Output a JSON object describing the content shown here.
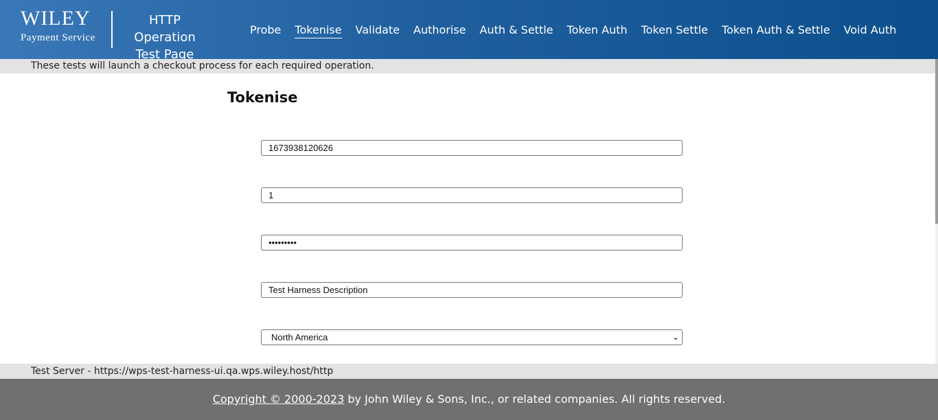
{
  "header": {
    "logo_main": "WILEY",
    "logo_sub": "Payment Service",
    "title_line1": "HTTP Operation",
    "title_line2": "Test Page",
    "nav": [
      {
        "label": "Probe"
      },
      {
        "label": "Tokenise",
        "active": true
      },
      {
        "label": "Validate"
      },
      {
        "label": "Authorise"
      },
      {
        "label": "Auth & Settle"
      },
      {
        "label": "Token Auth"
      },
      {
        "label": "Token Settle"
      },
      {
        "label": "Token Auth & Settle"
      },
      {
        "label": "Void Auth"
      }
    ]
  },
  "subbar_text": "These tests will launch a checkout process for each required operation.",
  "main": {
    "title": "Tokenise",
    "fields": [
      {
        "value": "1673938120626"
      },
      {
        "value": "1"
      },
      {
        "value": "•••••••••"
      },
      {
        "value": "Test Harness Description"
      },
      {
        "value": "North America"
      }
    ]
  },
  "server_text": "Test Server - https://wps-test-harness-ui.qa.wps.wiley.host/http",
  "footer": {
    "copyright_link": "Copyright © 2000-2023",
    "copyright_rest": " by John Wiley & Sons, Inc., or related companies. All rights reserved."
  },
  "colors": {
    "header_start": "#3a78b8",
    "header_end": "#0d4f8c",
    "subbar_bg": "#e3e3e3",
    "footer_bg": "#707070"
  }
}
